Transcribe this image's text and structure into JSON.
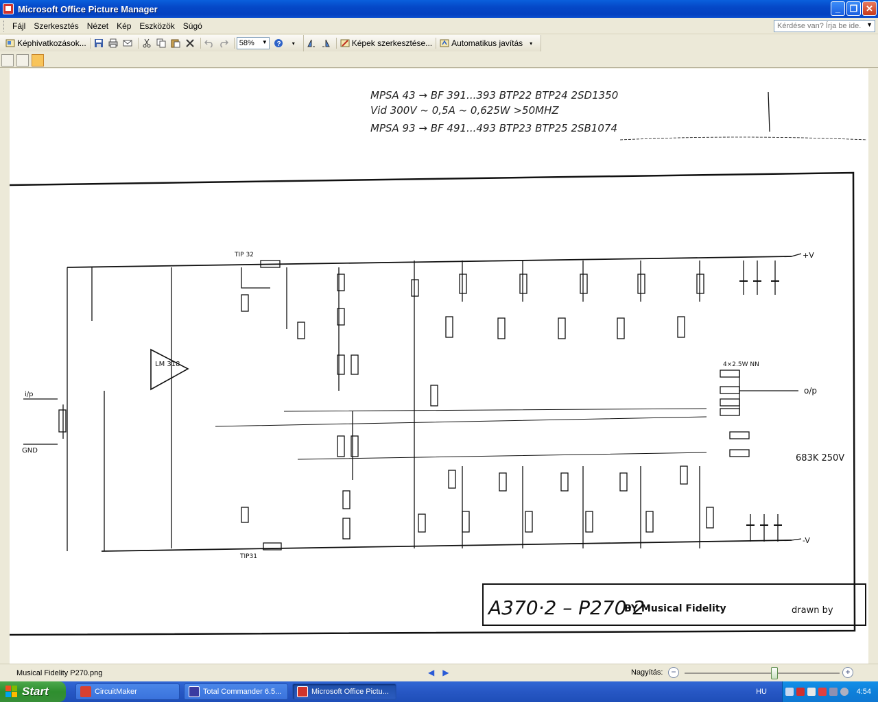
{
  "window": {
    "title": "Microsoft Office Picture Manager"
  },
  "menu": {
    "items": [
      "Fájl",
      "Szerkesztés",
      "Nézet",
      "Kép",
      "Eszközök",
      "Súgó"
    ],
    "help_placeholder": "Kérdése van? Írja be ide."
  },
  "toolbar": {
    "shortcuts_label": "Képhivatkozások...",
    "zoom_value": "58%",
    "edit_label": "Képek szerkesztése...",
    "autofix_label": "Automatikus javítás"
  },
  "document": {
    "notes": [
      "MPSA 43 → BF 391...393 BTP22 BTP24 2SD1350",
      "Vid 300V ~ 0,5A ~ 0,625W >50MHZ",
      "MPSA 93 → BF 491...493 BTP23 BTP25 2SB1074"
    ],
    "schematic_title": "A370·2 – P270·2",
    "schematic_by": "BY Musical Fidelity",
    "drawn_by": "drawn by",
    "labels": {
      "ic": "LM 318",
      "plus_v": "+V",
      "minus_v": "-V",
      "output": "o/p",
      "input": "i/p",
      "gnd": "GND",
      "tip1": "TIP 32",
      "tip2": "TIP31",
      "output_res": "4×2.5W NN",
      "cap_note": "683K 250V"
    }
  },
  "status": {
    "filename": "Musical Fidelity P270.png",
    "zoom_label": "Nagyítás:",
    "zoom_slider_fraction": 0.58
  },
  "taskbar": {
    "start_label": "Start",
    "tasks": [
      "CircuitMaker",
      "Total Commander 6.5...",
      "Microsoft Office Pictu..."
    ],
    "language": "HU",
    "clock": "4:54"
  }
}
